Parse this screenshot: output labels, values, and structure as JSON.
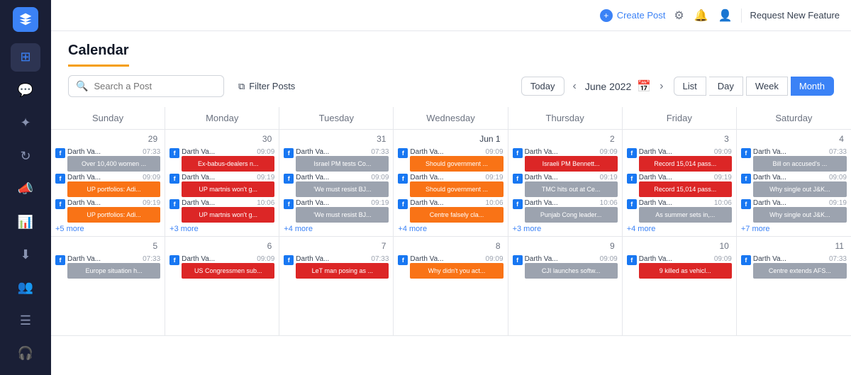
{
  "topnav": {
    "create_post": "Create Post",
    "request_feature": "Request New Feature"
  },
  "calendar": {
    "title": "Calendar",
    "search_placeholder": "Search a Post",
    "filter_label": "Filter Posts",
    "today_label": "Today",
    "month_display": "June 2022",
    "view_buttons": [
      "List",
      "Day",
      "Week",
      "Month"
    ],
    "active_view": "Month",
    "day_headers": [
      "Sunday",
      "Monday",
      "Tuesday",
      "Wednesday",
      "Thursday",
      "Friday",
      "Saturday"
    ]
  },
  "weeks": [
    {
      "days": [
        {
          "num": "29",
          "jun": false,
          "posts": [
            {
              "user": "Darth Va...",
              "time": "07:33",
              "title": "Over 10,400 women ...",
              "color": "gray"
            },
            {
              "user": "Darth Va...",
              "time": "09:09",
              "title": "UP portfolios: Adi...",
              "color": "orange"
            },
            {
              "user": "Darth Va...",
              "time": "09:19",
              "title": "UP portfolios: Adi...",
              "color": "orange"
            }
          ],
          "more": "+5 more"
        },
        {
          "num": "30",
          "jun": false,
          "posts": [
            {
              "user": "Darth Va...",
              "time": "09:09",
              "title": "Ex-babus-dealers n...",
              "color": "red"
            },
            {
              "user": "Darth Va...",
              "time": "09:19",
              "title": "UP martnis won't g...",
              "color": "red"
            },
            {
              "user": "Darth Va...",
              "time": "10:06",
              "title": "UP martnis won't g...",
              "color": "red"
            }
          ],
          "more": "+3 more"
        },
        {
          "num": "31",
          "jun": false,
          "posts": [
            {
              "user": "Darth Va...",
              "time": "07:33",
              "title": "Israel PM tests Co...",
              "color": "gray"
            },
            {
              "user": "Darth Va...",
              "time": "09:09",
              "title": "'We must resist BJ...",
              "color": "gray"
            },
            {
              "user": "Darth Va...",
              "time": "09:19",
              "title": "'We must resist BJ...",
              "color": "gray"
            }
          ],
          "more": "+4 more"
        },
        {
          "num": "Jun 1",
          "jun": true,
          "posts": [
            {
              "user": "Darth Va...",
              "time": "09:09",
              "title": "Should government ...",
              "color": "orange"
            },
            {
              "user": "Darth Va...",
              "time": "09:19",
              "title": "Should government ...",
              "color": "orange"
            },
            {
              "user": "Darth Va...",
              "time": "10:06",
              "title": "Centre falsely cla...",
              "color": "orange"
            }
          ],
          "more": "+4 more"
        },
        {
          "num": "2",
          "jun": false,
          "posts": [
            {
              "user": "Darth Va...",
              "time": "09:09",
              "title": "Israeli PM Bennett...",
              "color": "red"
            },
            {
              "user": "Darth Va...",
              "time": "09:19",
              "title": "TMC hits out at Ce...",
              "color": "gray"
            },
            {
              "user": "Darth Va...",
              "time": "10:06",
              "title": "Punjab Cong leader...",
              "color": "gray"
            }
          ],
          "more": "+3 more"
        },
        {
          "num": "3",
          "jun": false,
          "posts": [
            {
              "user": "Darth Va...",
              "time": "09:09",
              "title": "Record 15,014 pass...",
              "color": "red"
            },
            {
              "user": "Darth Va...",
              "time": "09:19",
              "title": "Record 15,014 pass...",
              "color": "red"
            },
            {
              "user": "Darth Va...",
              "time": "10:06",
              "title": "As summer sets in,...",
              "color": "gray"
            }
          ],
          "more": "+4 more"
        },
        {
          "num": "4",
          "jun": false,
          "posts": [
            {
              "user": "Darth Va...",
              "time": "07:33",
              "title": "Bill on accused's ...",
              "color": "gray"
            },
            {
              "user": "Darth Va...",
              "time": "09:09",
              "title": "Why single out J&K...",
              "color": "gray"
            },
            {
              "user": "Darth Va...",
              "time": "09:19",
              "title": "Why single out J&K...",
              "color": "gray"
            }
          ],
          "more": "+7 more"
        }
      ]
    },
    {
      "days": [
        {
          "num": "5",
          "jun": false,
          "posts": [
            {
              "user": "Darth Va...",
              "time": "07:33",
              "title": "Europe situation h...",
              "color": "gray"
            }
          ],
          "more": null
        },
        {
          "num": "6",
          "jun": false,
          "posts": [
            {
              "user": "Darth Va...",
              "time": "09:09",
              "title": "US Congressmen sub...",
              "color": "red"
            }
          ],
          "more": null
        },
        {
          "num": "7",
          "jun": false,
          "posts": [
            {
              "user": "Darth Va...",
              "time": "07:33",
              "title": "LeT man posing as ...",
              "color": "red"
            }
          ],
          "more": null
        },
        {
          "num": "8",
          "jun": false,
          "posts": [
            {
              "user": "Darth Va...",
              "time": "09:09",
              "title": "Why didn't you act...",
              "color": "orange"
            }
          ],
          "more": null
        },
        {
          "num": "9",
          "jun": false,
          "posts": [
            {
              "user": "Darth Va...",
              "time": "09:09",
              "title": "CJI launches softw...",
              "color": "gray"
            }
          ],
          "more": null
        },
        {
          "num": "10",
          "jun": false,
          "posts": [
            {
              "user": "Darth Va...",
              "time": "09:09",
              "title": "9 killed as vehicl...",
              "color": "red"
            }
          ],
          "more": null
        },
        {
          "num": "11",
          "jun": false,
          "posts": [
            {
              "user": "Darth Va...",
              "time": "07:33",
              "title": "Centre extends AFS...",
              "color": "gray"
            }
          ],
          "more": null
        }
      ]
    }
  ],
  "sidebar": {
    "items": [
      "grid",
      "chat",
      "star",
      "refresh",
      "megaphone",
      "chart",
      "download",
      "users",
      "list",
      "headset"
    ]
  }
}
